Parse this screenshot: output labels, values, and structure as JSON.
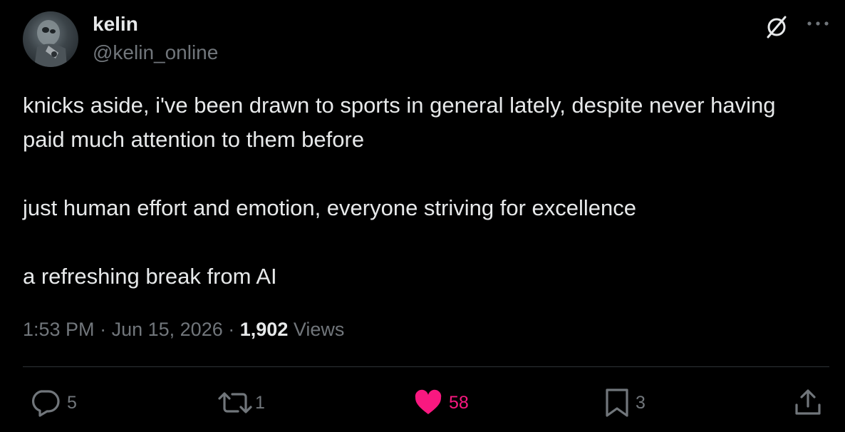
{
  "author": {
    "display_name": "kelin",
    "handle": "@kelin_online"
  },
  "icons": {
    "grok": "grok-icon",
    "more": "more-icon",
    "reply": "reply-icon",
    "repost": "repost-icon",
    "like": "heart-icon",
    "bookmark": "bookmark-icon",
    "share": "share-icon"
  },
  "tweet": {
    "paragraphs": [
      "knicks aside, i've been drawn to sports in general lately, despite never having paid much attention to them before",
      "just human effort and emotion, everyone striving for excellence",
      "a refreshing break from AI"
    ]
  },
  "meta": {
    "time": "1:53 PM",
    "separator": "·",
    "date": "Jun 15, 2026",
    "views_count": "1,902",
    "views_label": "Views"
  },
  "actions": {
    "replies": "5",
    "reposts": "1",
    "likes": "58",
    "bookmarks": "3"
  },
  "colors": {
    "background": "#000000",
    "text": "#e7e9ea",
    "secondary": "#71767b",
    "like": "#f91880",
    "divider": "#2f3336"
  }
}
